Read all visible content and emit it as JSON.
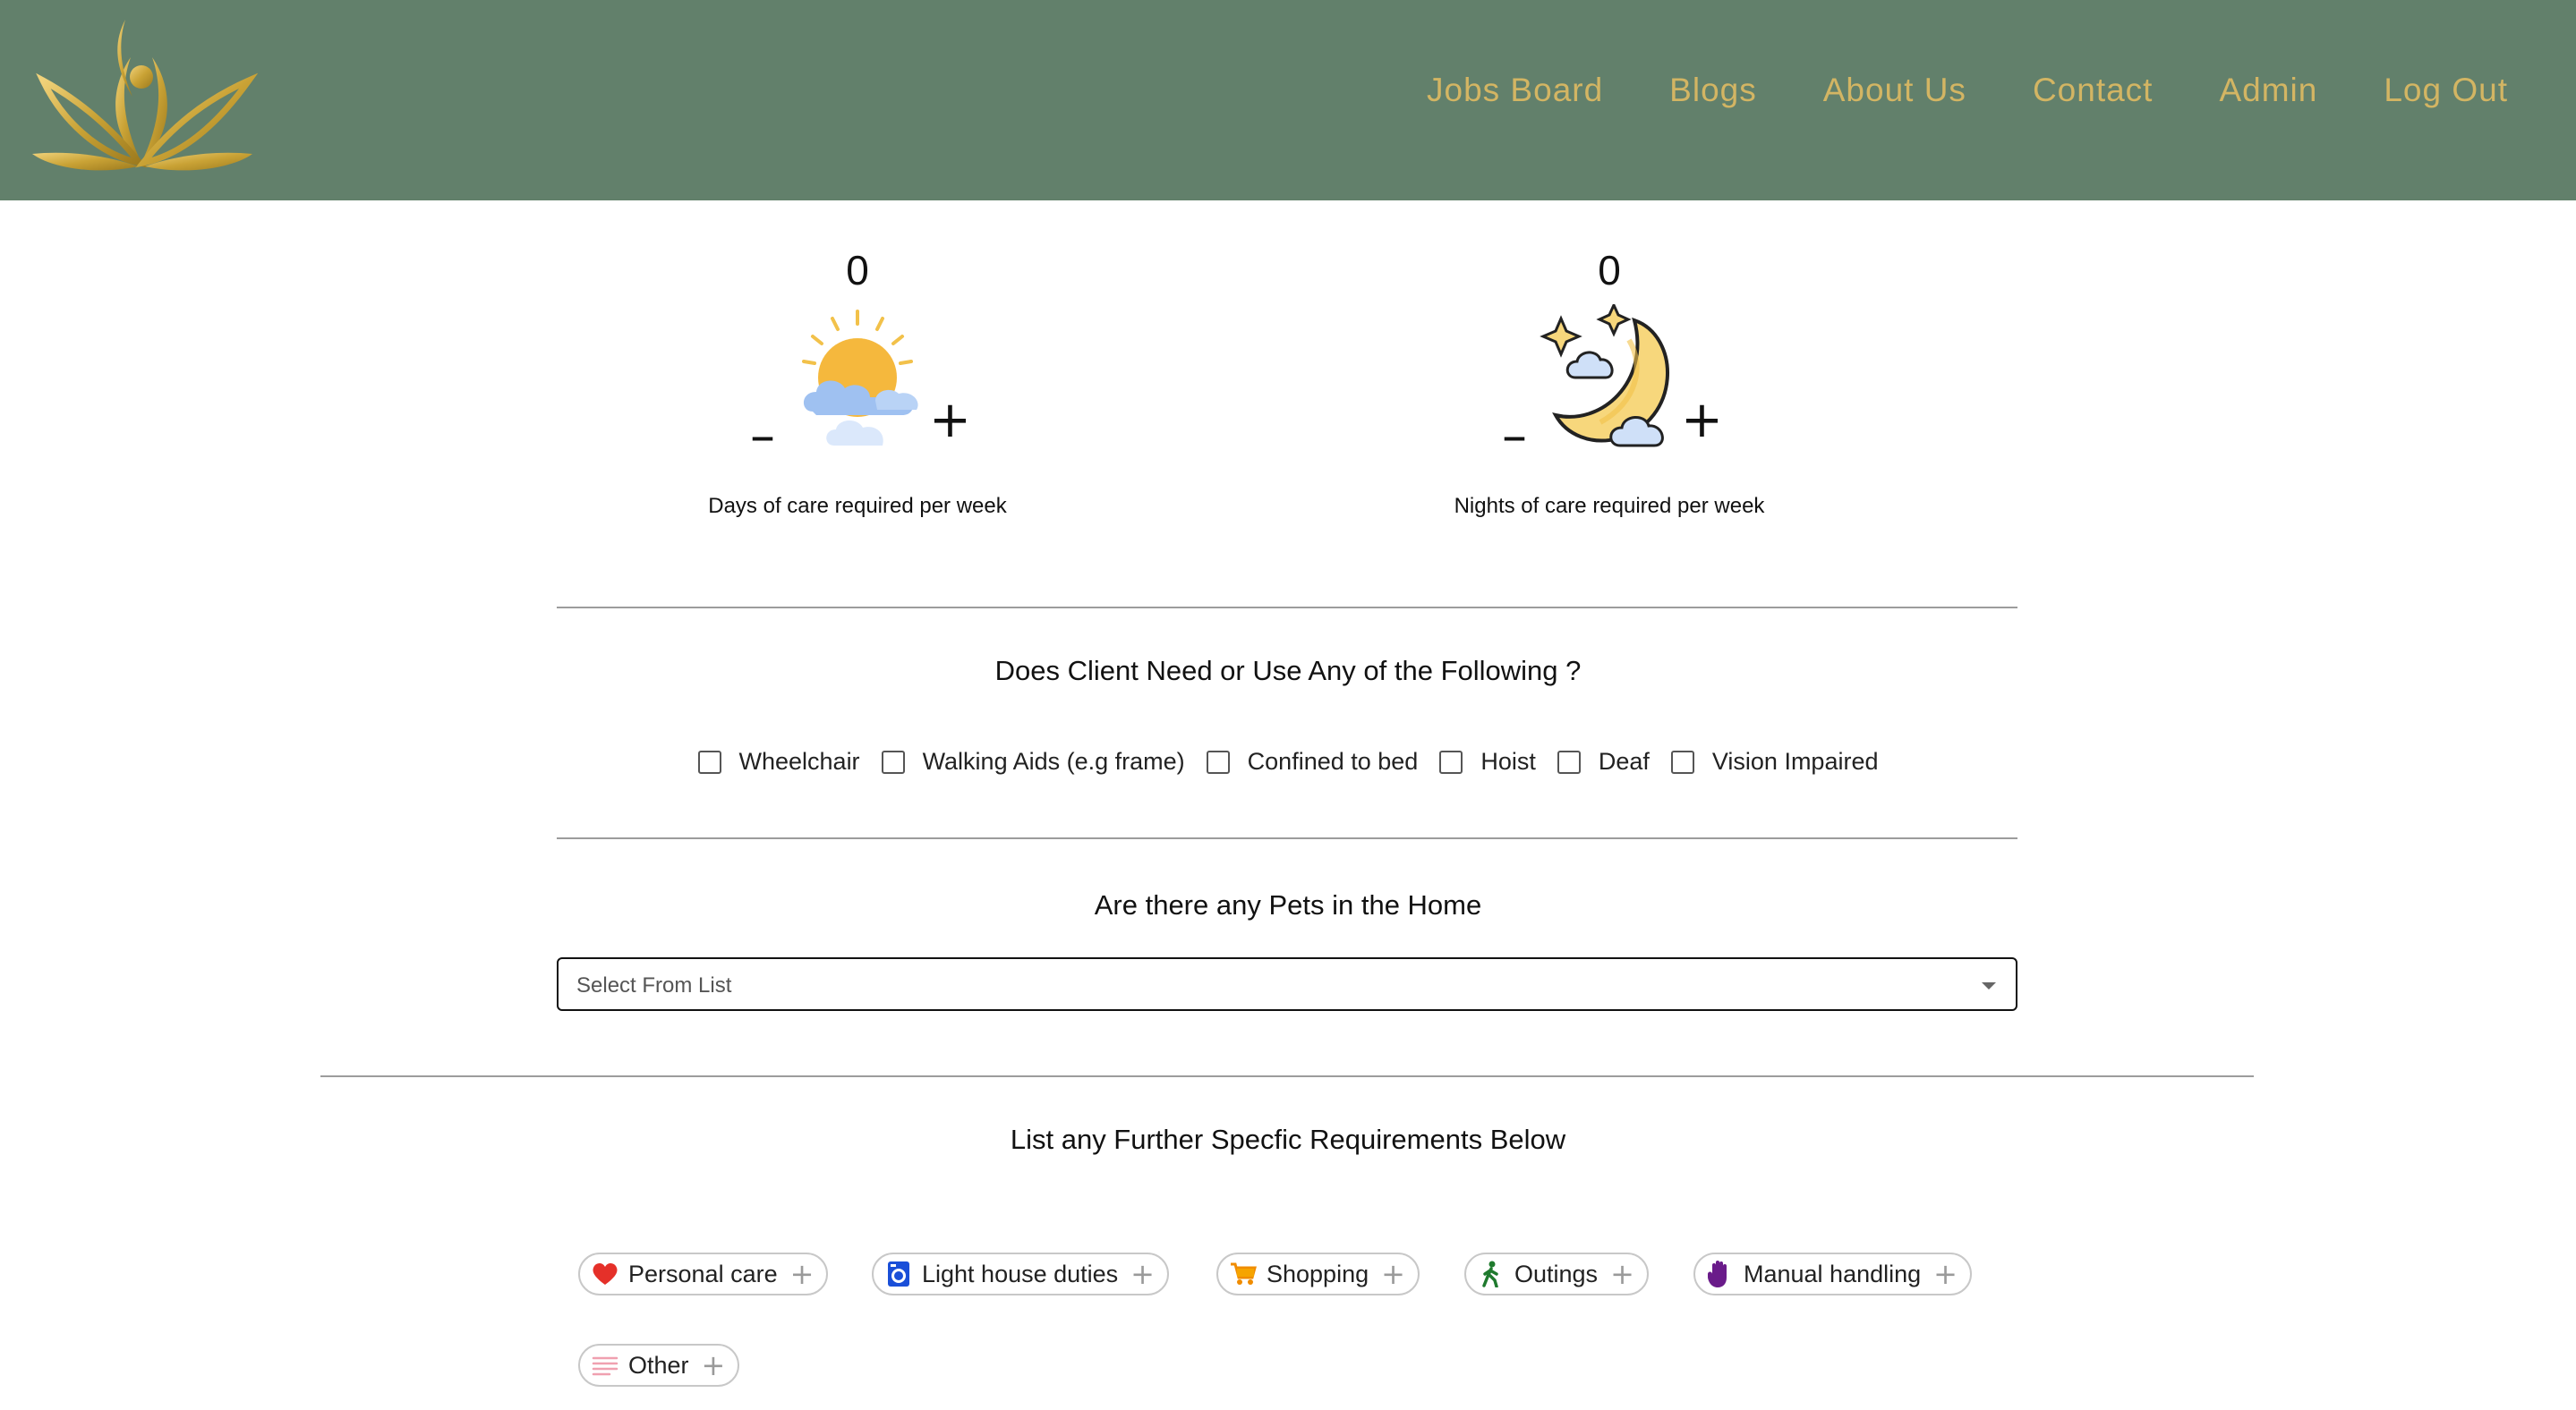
{
  "nav": {
    "items": [
      "Jobs Board",
      "Blogs",
      "About Us",
      "Contact",
      "Admin",
      "Log Out"
    ]
  },
  "days": {
    "count": "0",
    "minus": "–",
    "plus": "+",
    "label": "Days of care required per week"
  },
  "nights": {
    "count": "0",
    "minus": "–",
    "plus": "+",
    "label": "Nights of care required per week"
  },
  "equipment": {
    "title": "Does Client Need or Use Any of the Following ?",
    "options": [
      "Wheelchair",
      "Walking Aids (e.g frame)",
      "Confined to bed",
      "Hoist",
      "Deaf",
      "Vision Impaired"
    ]
  },
  "pets": {
    "title": "Are there any Pets in the Home",
    "placeholder": "Select From List"
  },
  "requirements": {
    "title": "List any Further Specfic Requirements Below",
    "chips": [
      {
        "label": "Personal care",
        "icon": "heart-icon"
      },
      {
        "label": "Light house duties",
        "icon": "washing-machine-icon"
      },
      {
        "label": "Shopping",
        "icon": "shopping-cart-icon"
      },
      {
        "label": "Outings",
        "icon": "walking-person-icon"
      },
      {
        "label": "Manual handling",
        "icon": "raised-hand-icon"
      },
      {
        "label": "Other",
        "icon": "lines-icon"
      }
    ],
    "add_symbol": "+"
  },
  "colors": {
    "header_bg": "#62806b",
    "nav_text": "#d3b563",
    "logo_gold": "#c9a235"
  }
}
